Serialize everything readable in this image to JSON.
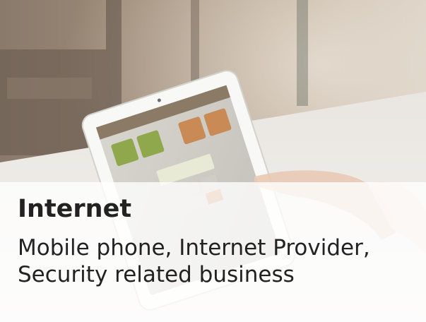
{
  "card": {
    "title": "Internet",
    "description": "Mobile phone, Internet Provider, Security related business",
    "image_icon": "tablet-photo",
    "colors": {
      "caption_overlay": "#ffffff",
      "text": "#222222"
    }
  }
}
